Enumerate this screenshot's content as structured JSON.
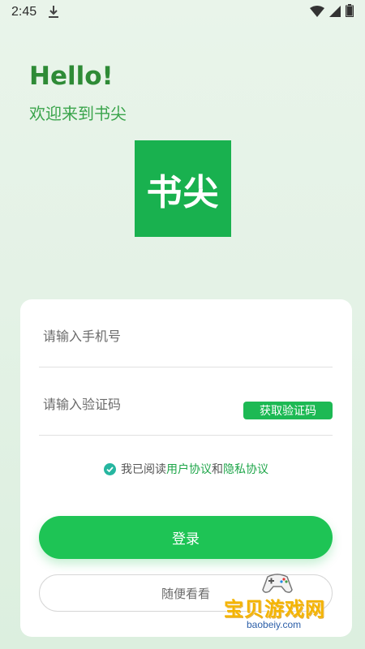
{
  "status_bar": {
    "time": "2:45",
    "icons": [
      "download-icon",
      "wifi-icon",
      "signal-icon",
      "battery-icon"
    ]
  },
  "greeting": {
    "hello": "Hello!",
    "welcome": "欢迎来到书尖"
  },
  "logo": {
    "text": "书尖",
    "color": "#19b14f"
  },
  "form": {
    "phone_placeholder": "请输入手机号",
    "code_placeholder": "请输入验证码",
    "get_code_label": "获取验证码",
    "agreement": {
      "prefix": "我已阅读",
      "user_agreement": "用户协议",
      "and": "和",
      "privacy_policy": "隐私协议",
      "checked": true
    },
    "login_label": "登录",
    "browse_label": "随便看看"
  },
  "colors": {
    "accent": "#1ec455",
    "title": "#2e8b36",
    "link": "#1fa64a"
  },
  "watermark": {
    "title": "宝贝游戏网",
    "url": "baobeiy.com"
  }
}
